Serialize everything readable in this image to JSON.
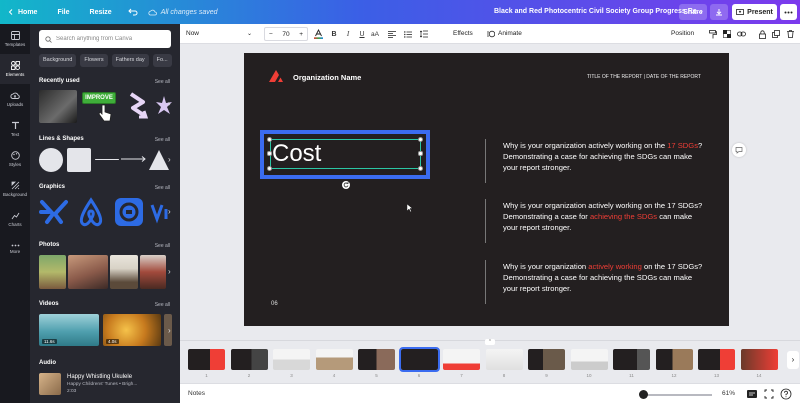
{
  "topbar": {
    "home": "Home",
    "file": "File",
    "resize": "Resize",
    "saved_status": "All changes saved",
    "doc_title": "Black and Red Photocentric Civil Society Group Progress Re...",
    "share": "Share",
    "present": "Present"
  },
  "rail": [
    {
      "label": "Templates",
      "icon": "templates-icon"
    },
    {
      "label": "Elements",
      "icon": "elements-icon"
    },
    {
      "label": "Uploads",
      "icon": "uploads-icon"
    },
    {
      "label": "Text",
      "icon": "text-icon"
    },
    {
      "label": "Styles",
      "icon": "styles-icon"
    },
    {
      "label": "Background",
      "icon": "background-icon"
    },
    {
      "label": "Charts",
      "icon": "charts-icon"
    },
    {
      "label": "More",
      "icon": "more-icon"
    }
  ],
  "panel": {
    "search_placeholder": "Search anything from Canva",
    "chips": [
      "Background",
      "Flowers",
      "Fathers day",
      "Fo..."
    ],
    "see_all": "See all",
    "sections": {
      "recently_used": "Recently used",
      "lines_shapes": "Lines & Shapes",
      "graphics": "Graphics",
      "photos": "Photos",
      "videos": "Videos",
      "audio": "Audio"
    },
    "improve_sticker": "IMPROVE",
    "video_durations": [
      "11.6s",
      "4.0s"
    ],
    "audio": {
      "title": "Happy Whistling Ukulele",
      "artist": "Happy Childrens' Tunes • Brigh...",
      "duration": "2:03"
    }
  },
  "toolbar": {
    "font": "Now",
    "font_size": "70",
    "effects": "Effects",
    "animate": "Animate",
    "position": "Position"
  },
  "slide": {
    "org_name": "Organization Name",
    "report_header": "TITLE OF THE REPORT | DATE OF THE REPORT",
    "selected_text": "Cost",
    "page_number": "06",
    "para1": {
      "a": "Why is your organization actively working on the ",
      "b": "17 SDGs",
      "c": "? Demonstrating a case for achieving the SDGs can make your report stronger."
    },
    "para2": {
      "a": "Why is your organization actively working on the 17 SDGs? Demonstrating a case for ",
      "b": "achieving the SDGs",
      "c": " can make your report stronger."
    },
    "para3": {
      "a": "Why is your organization ",
      "b": "actively working",
      "c": " on the 17 SDGs? Demonstrating a case for achieving the SDGs can make your report stronger."
    },
    "highlight_color": "#ef3e36",
    "selection_color": "#3b6cf0"
  },
  "filmstrip": {
    "pages": [
      "1",
      "2",
      "3",
      "4",
      "5",
      "6",
      "7",
      "8",
      "9",
      "10",
      "11",
      "12",
      "13",
      "14"
    ],
    "selected": "6"
  },
  "bottombar": {
    "notes": "Notes",
    "zoom": "61%",
    "zoom_fraction": 0.02
  }
}
